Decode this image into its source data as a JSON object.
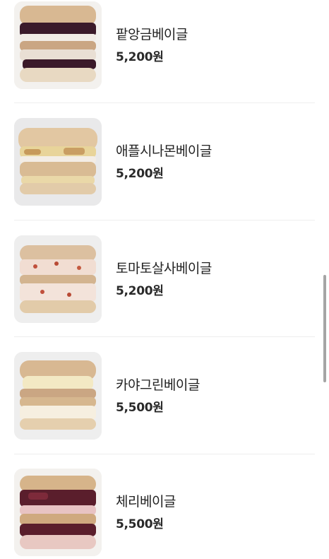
{
  "menu": {
    "items": [
      {
        "name": "팥앙금베이글",
        "price": "5,200원",
        "filling": "red-bean",
        "fill_color": "#3b1a2a",
        "top_color": "#d8b892"
      },
      {
        "name": "애플시나몬베이글",
        "price": "5,200원",
        "filling": "apple-cinnamon",
        "fill_color": "#e8d49a",
        "top_color": "#e2c7a2"
      },
      {
        "name": "토마토살사베이글",
        "price": "5,200원",
        "filling": "tomato-salsa",
        "fill_color": "#f1ddd2",
        "top_color": "#dcc0a0"
      },
      {
        "name": "카야그린베이글",
        "price": "5,500원",
        "filling": "kaya-green",
        "fill_color": "#f3e9c4",
        "top_color": "#d8b892"
      },
      {
        "name": "체리베이글",
        "price": "5,500원",
        "filling": "cherry",
        "fill_color": "#5a1e2c",
        "top_color": "#d6b48a"
      }
    ]
  },
  "colors": {
    "text": "#222222",
    "divider": "#eeeeee",
    "thumb_bg": "#efefef",
    "scrollbar": "#a5a5a5"
  }
}
